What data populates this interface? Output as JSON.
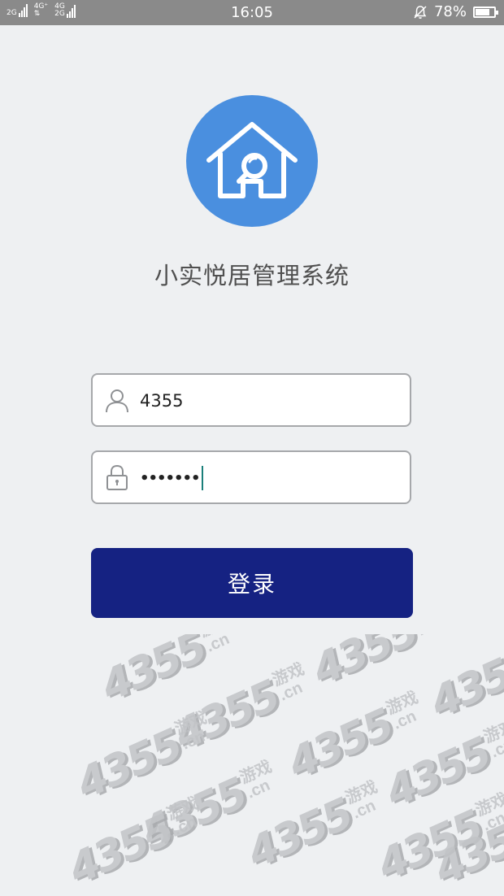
{
  "status_bar": {
    "sim1": {
      "line1": "2G",
      "line2": ""
    },
    "sim2": {
      "line1": "4G⁺",
      "line2": "⇅"
    },
    "sim3": {
      "line1": "4G",
      "line2": "2G"
    },
    "time": "16:05",
    "battery_percent": "78%",
    "battery_level": 0.78
  },
  "app": {
    "title": "小实悦居管理系统",
    "logo_color": "#4a8fdf"
  },
  "login_form": {
    "username_value": "4355",
    "password_mask": "•••••••",
    "login_label": "登录",
    "button_color": "#152282"
  },
  "watermark": {
    "number": "4355",
    "game": "游戏",
    "domain": ".cn"
  }
}
